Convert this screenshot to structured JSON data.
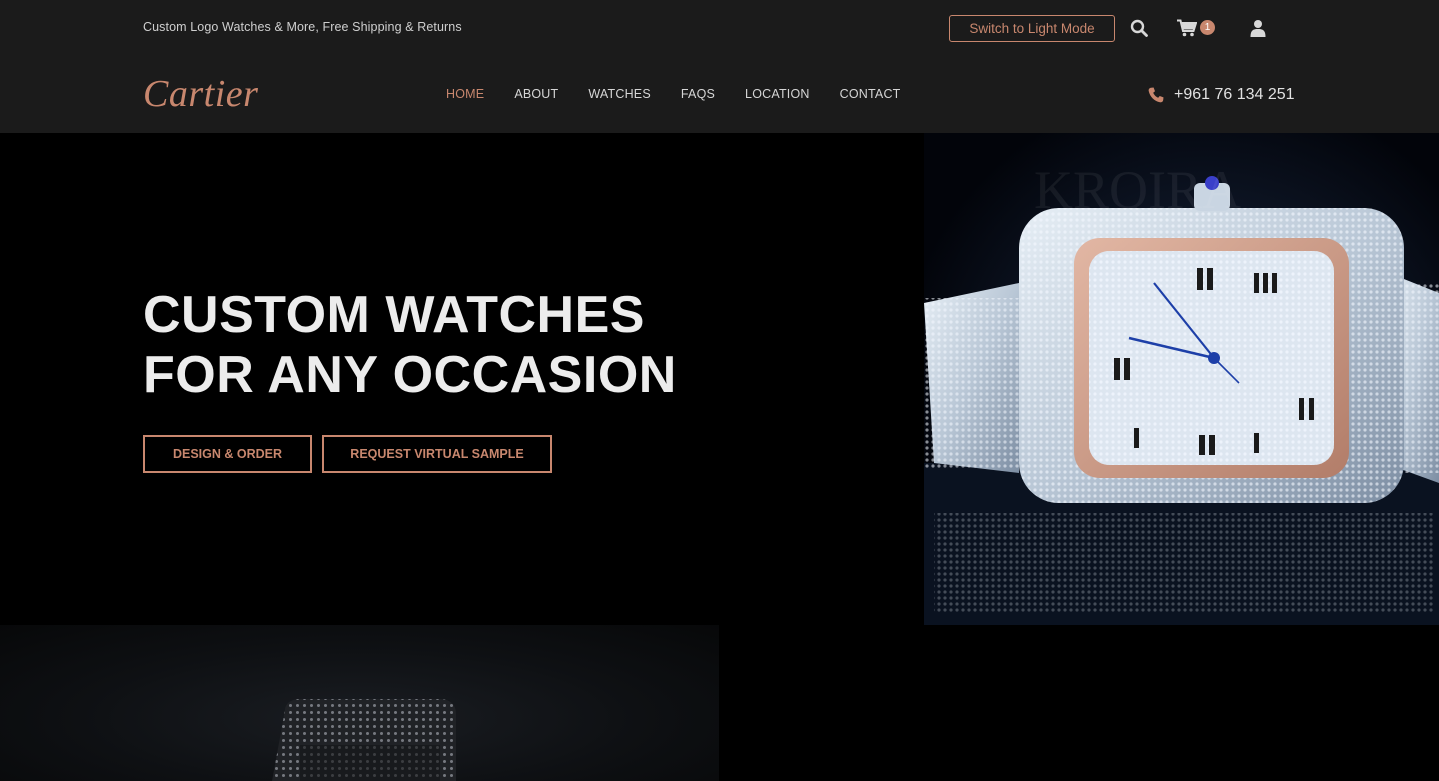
{
  "topbar": {
    "tagline": "Custom Logo Watches & More, Free Shipping & Returns",
    "mode_button": "Switch to Light Mode",
    "cart_count": "1",
    "icons": [
      "search-icon",
      "cart-icon",
      "user-icon"
    ]
  },
  "navbar": {
    "logo": "Cartier",
    "items": [
      {
        "label": "HOME",
        "active": true
      },
      {
        "label": "ABOUT"
      },
      {
        "label": "WATCHES"
      },
      {
        "label": "FAQS"
      },
      {
        "label": "LOCATION"
      },
      {
        "label": "CONTACT"
      }
    ],
    "phone": "+961 76 134 251"
  },
  "hero": {
    "title_line1": "CUSTOM WATCHES",
    "title_line2": "FOR ANY OCCASION",
    "design_button": "DESIGN & ORDER",
    "sample_button": "REQUEST VIRTUAL SAMPLE"
  },
  "colors": {
    "accent": "#c8876e",
    "bar_bg": "#1b1b1b",
    "hero_bg": "#000000"
  }
}
